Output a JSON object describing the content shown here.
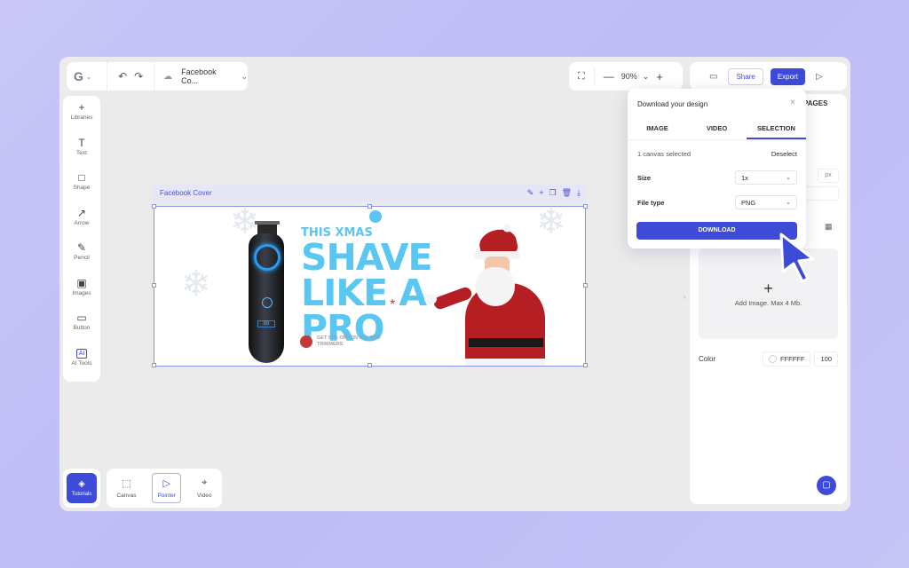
{
  "toolbar": {
    "logo_letter": "G",
    "doc_name": "Facebook Co...",
    "zoom": "90%",
    "share_label": "Share",
    "export_label": "Export"
  },
  "tools": [
    {
      "label": "Libraries",
      "icon": "+"
    },
    {
      "label": "Text",
      "icon": "T"
    },
    {
      "label": "Shape",
      "icon": "□"
    },
    {
      "label": "Arrow",
      "icon": "↗"
    },
    {
      "label": "Pencil",
      "icon": "✎"
    },
    {
      "label": "Images",
      "icon": "▣"
    },
    {
      "label": "Button",
      "icon": "▭"
    },
    {
      "label": "AI Tools",
      "icon": "AI"
    }
  ],
  "bottom": {
    "tutorials_label": "Tutorials",
    "canvas_label": "Canvas",
    "pointer_label": "Pointer",
    "video_label": "Video"
  },
  "canvas": {
    "name": "Facebook Cover",
    "design": {
      "line1": "THIS XMAS",
      "line2": "SHAVE",
      "line3": "LIKE A",
      "line4": "PRO",
      "offer_line1": "GET 50% OFF ON ALL PRO",
      "offer_line2": "TRIMMERS"
    }
  },
  "side_panel": {
    "tab_pages": "PAGES",
    "unit": "px",
    "upload_label": "Add Image. Max 4 Mb.",
    "color_label": "Color",
    "color_hex": "FFFFFF",
    "opacity": "100"
  },
  "download_modal": {
    "title": "Download your design",
    "tabs": [
      "IMAGE",
      "VIDEO",
      "SELECTION"
    ],
    "active_tab": "SELECTION",
    "selected_text": "1 canvas selected",
    "deselect_label": "Deselect",
    "size_label": "Size",
    "size_value": "1x",
    "filetype_label": "File type",
    "filetype_value": "PNG",
    "download_label": "DOWNLOAD"
  },
  "colors": {
    "accent": "#3d4bd8",
    "headline": "#5ac6f2",
    "santa_red": "#b51f24"
  }
}
